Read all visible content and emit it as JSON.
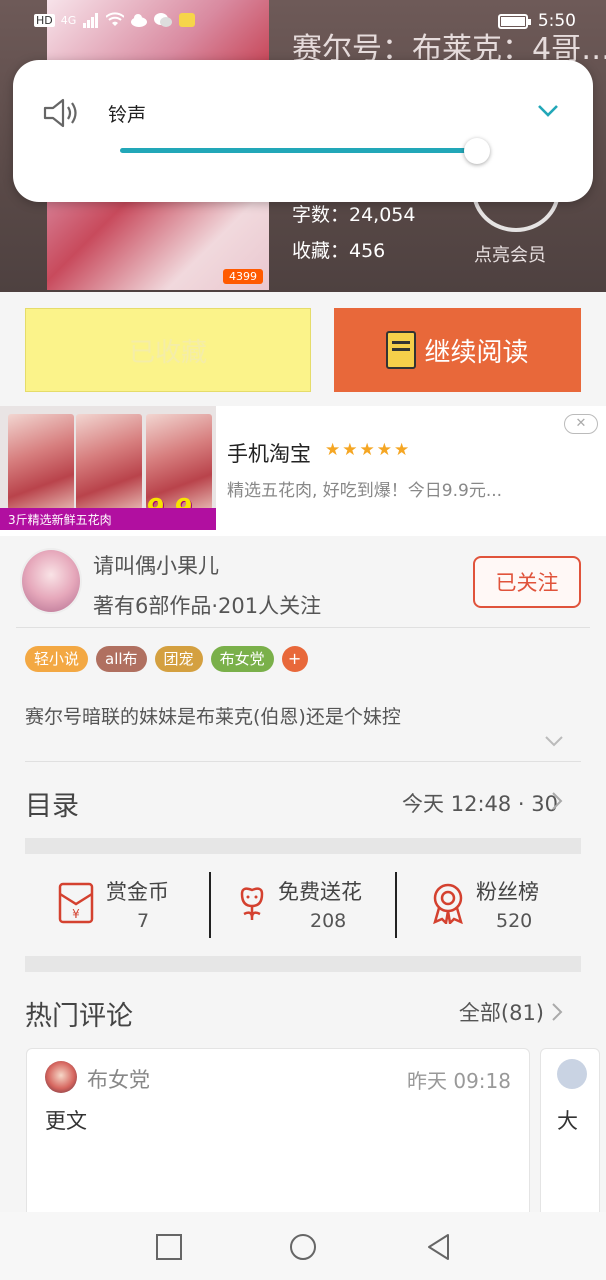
{
  "status_bar": {
    "network": "4G",
    "hd": "HD",
    "time": "5:50"
  },
  "book": {
    "title": "赛尔号：布莱克：4哥…",
    "words": "字数：24,054",
    "favorites": "收藏：456",
    "vip_label": "点亮会员",
    "cover_badge": "4399"
  },
  "volume_panel": {
    "label": "铃声",
    "level_percent": 98,
    "accent_color": "#22a7b8"
  },
  "actions": {
    "favorited_label": "已收藏",
    "continue_label": "继续阅读"
  },
  "ad": {
    "title": "手机淘宝",
    "stars": "★★★★★",
    "description": "精选五花肉, 好吃到爆！今日9.9元...",
    "image_price": "9.9",
    "image_unit": "元起",
    "image_caption": "3斤精选新鲜五花肉",
    "close_label": "✕"
  },
  "author": {
    "name": "请叫偶小果儿",
    "stats": "著有6部作品·201人关注",
    "follow_label": "已关注"
  },
  "tags": [
    {
      "label": "轻小说",
      "color": "#f3a843"
    },
    {
      "label": "all布",
      "color": "#b07060"
    },
    {
      "label": "团宠",
      "color": "#d4a040"
    },
    {
      "label": "布女党",
      "color": "#7ab04a"
    }
  ],
  "tag_add": "+",
  "intro": "赛尔号暗联的妹妹是布莱克(伯恩)还是个妹控",
  "catalog": {
    "title": "目录",
    "info": "今天 12:48 · 30"
  },
  "stats": [
    {
      "label": "赏金币",
      "value": "7",
      "icon": "red-envelope-icon"
    },
    {
      "label": "免费送花",
      "value": "208",
      "icon": "flower-icon"
    },
    {
      "label": "粉丝榜",
      "value": "520",
      "icon": "medal-icon"
    }
  ],
  "comments": {
    "title": "热门评论",
    "all_label": "全部(81)",
    "items": [
      {
        "user": "布女党",
        "time": "昨天 09:18",
        "text": "更文"
      },
      {
        "text": "大"
      }
    ]
  }
}
